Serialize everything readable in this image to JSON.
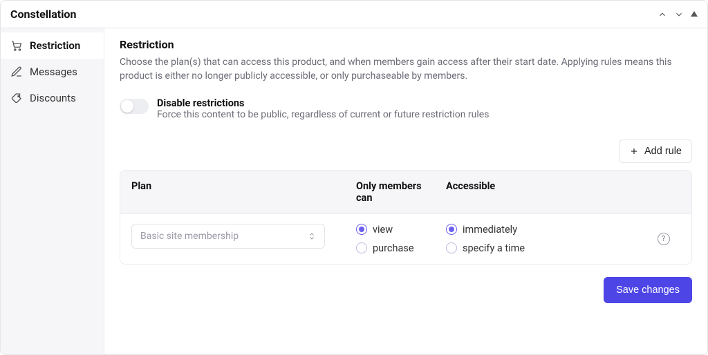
{
  "titlebar": {
    "title": "Constellation"
  },
  "sidebar": {
    "items": [
      {
        "label": "Restriction"
      },
      {
        "label": "Messages"
      },
      {
        "label": "Discounts"
      }
    ]
  },
  "main": {
    "heading": "Restriction",
    "description": "Choose the plan(s) that can access this product, and when members gain access after their start date. Applying rules means this product is either no longer publicly accessible, or only purchaseable by members.",
    "toggle": {
      "title": "Disable restrictions",
      "subtitle": "Force this content to be public, regardless of current or future restriction rules"
    },
    "add_rule_label": "Add rule",
    "table": {
      "headers": {
        "plan": "Plan",
        "members": "Only members can",
        "access": "Accessible"
      },
      "row": {
        "plan_placeholder": "Basic site membership",
        "members_options": {
          "view": "view",
          "purchase": "purchase"
        },
        "access_options": {
          "immediately": "immediately",
          "specify": "specify a time"
        }
      }
    },
    "save_label": "Save changes",
    "help_glyph": "?"
  }
}
